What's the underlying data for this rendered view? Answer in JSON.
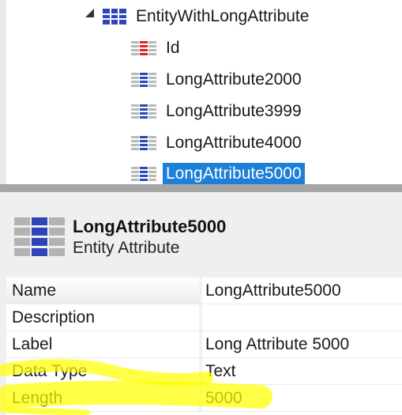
{
  "tree": {
    "entity": {
      "label": "EntityWithLongAttribute",
      "icon": "entity-table-icon"
    },
    "attributes": [
      {
        "label": "Id",
        "icon": "identifier-attribute-icon",
        "selected": false
      },
      {
        "label": "LongAttribute2000",
        "icon": "attribute-icon",
        "selected": false
      },
      {
        "label": "LongAttribute3999",
        "icon": "attribute-icon",
        "selected": false
      },
      {
        "label": "LongAttribute4000",
        "icon": "attribute-icon",
        "selected": false
      },
      {
        "label": "LongAttribute5000",
        "icon": "attribute-icon",
        "selected": true
      }
    ]
  },
  "details": {
    "title": "LongAttribute5000",
    "subtitle": "Entity Attribute",
    "icon": "entity-attribute-icon"
  },
  "properties": [
    {
      "name": "Name",
      "value": "LongAttribute5000"
    },
    {
      "name": "Description",
      "value": ""
    },
    {
      "name": "Label",
      "value": "Long Attribute 5000"
    },
    {
      "name": "Data Type",
      "value": "Text"
    },
    {
      "name": "Length",
      "value": "5000"
    }
  ],
  "colors": {
    "selection": "#1e7fd8",
    "attribute_icon": "#2d45b8",
    "id_icon": "#d9232b",
    "highlight": "#ffff00"
  }
}
